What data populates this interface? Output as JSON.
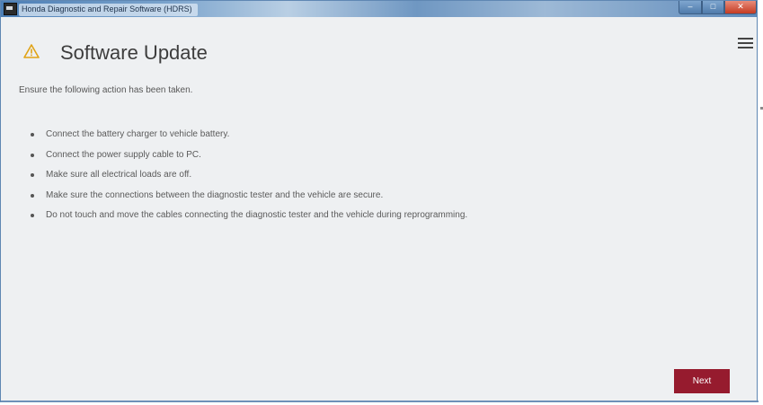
{
  "window": {
    "title": "Honda Diagnostic and Repair Software (HDRS)",
    "controls": {
      "minimize": "–",
      "maximize": "□",
      "close": "✕"
    }
  },
  "header": {
    "title": "Software Update",
    "icon": "warning-triangle-icon",
    "menu_icon": "hamburger-menu-icon"
  },
  "content": {
    "intro": "Ensure the following action has been taken.",
    "items": [
      "Connect the battery charger to vehicle battery.",
      "Connect the power supply cable to PC.",
      "Make sure all electrical loads are off.",
      "Make sure the connections between the diagnostic tester and the vehicle are secure.",
      "Do not touch and move the cables connecting the diagnostic tester and the vehicle during reprogramming."
    ]
  },
  "footer": {
    "next_label": "Next"
  },
  "colors": {
    "accent": "#961b2e",
    "warning": "#e0a316",
    "background": "#eef0f2",
    "titlebar": "#4d7fb6"
  }
}
